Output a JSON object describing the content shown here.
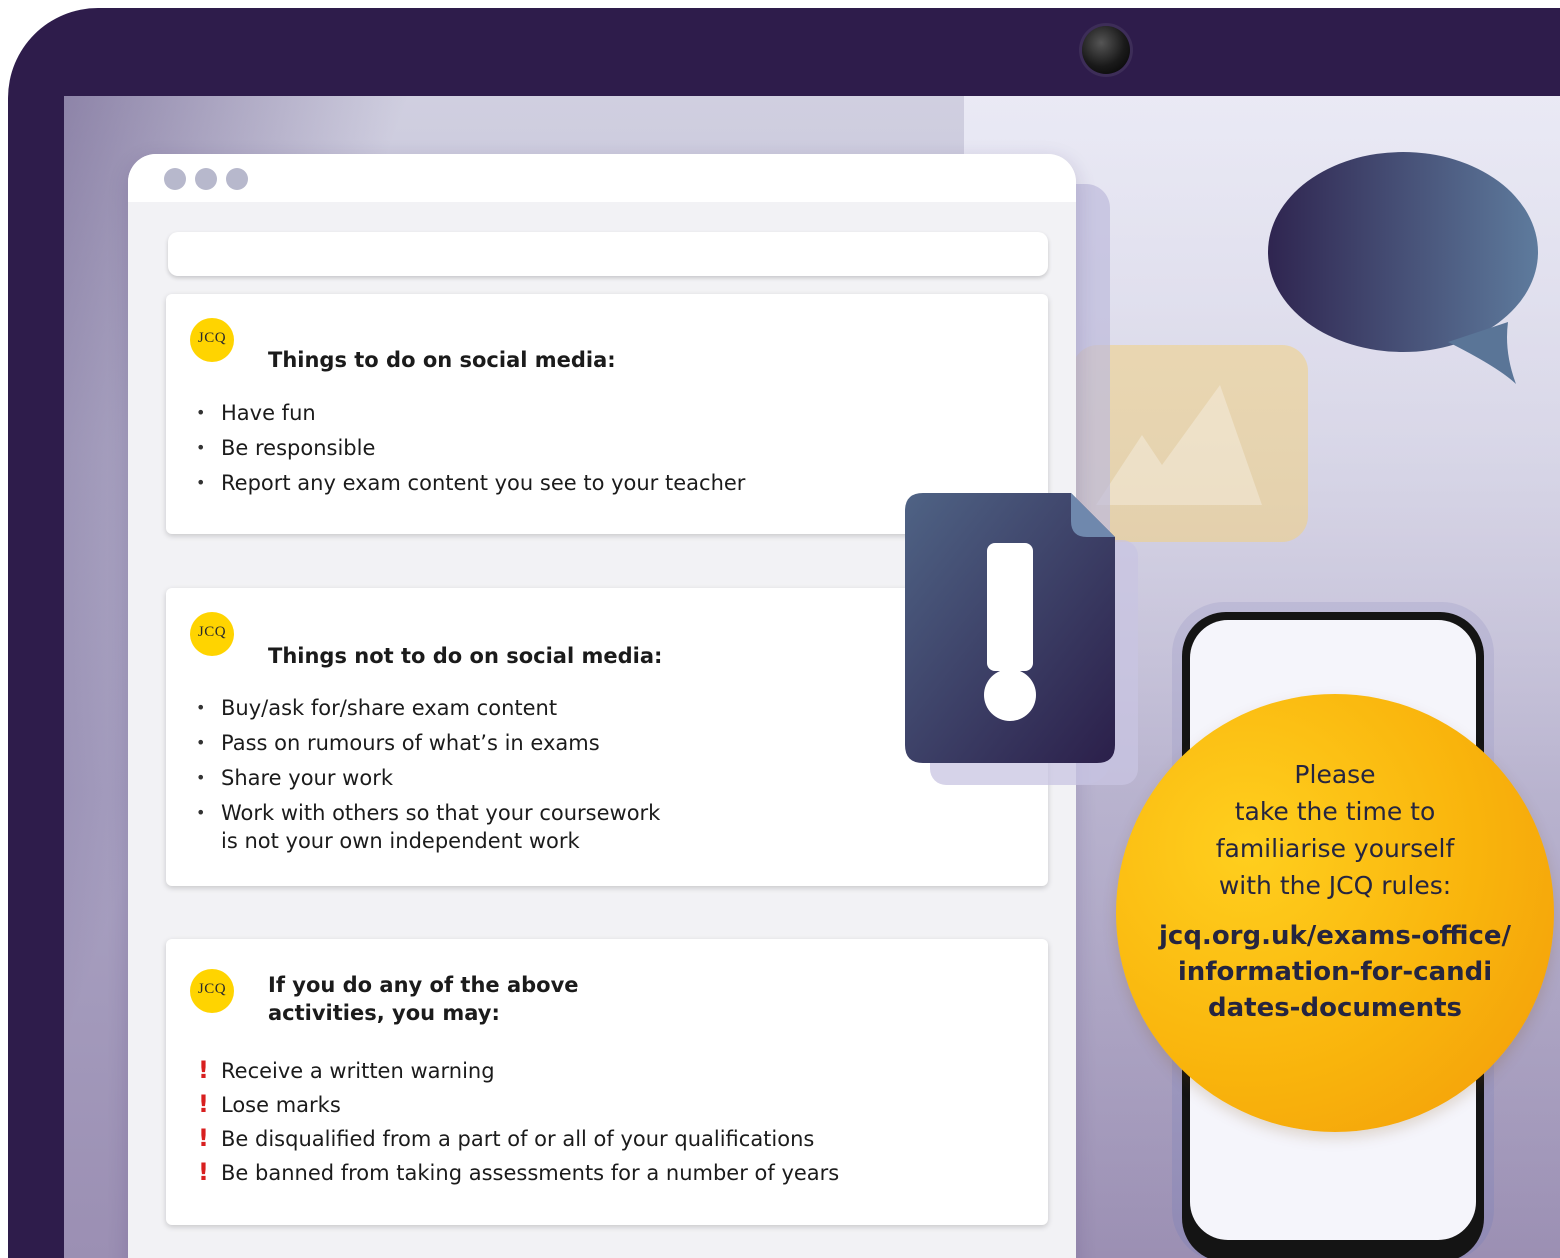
{
  "cards": [
    {
      "logo": "JCQ",
      "title": "Things to do on social media:",
      "items": [
        "Have fun",
        "Be responsible",
        "Report any exam content you see to your teacher"
      ]
    },
    {
      "logo": "JCQ",
      "title": "Things not to do on social media:",
      "items": [
        "Buy/ask for/share exam content",
        "Pass on rumours of what’s in exams",
        "Share your work",
        "Work with others so that your coursework",
        "is not your own independent work"
      ]
    },
    {
      "logo": "JCQ",
      "title_line1": "If you do any of the above",
      "title_line2": "activities, you may:",
      "items": [
        "Receive a written warning",
        "Lose marks",
        "Be disqualified from a part of or all of your qualifications",
        "Be banned from taking assessments for a number of years"
      ]
    }
  ],
  "callout": {
    "lines": [
      "Please",
      "take the time to",
      "familiarise yourself",
      "with the JCQ rules:"
    ],
    "link_lines": [
      "jcq.org.uk/exams-office/",
      "information-for-candi",
      "dates-documents"
    ]
  },
  "colors": {
    "frame": "#2e1c4b",
    "logo": "#ffd400",
    "warning": "#d81f1f",
    "callout": "#f9b40c"
  },
  "icons": [
    "webcam-icon",
    "speech-bubble-icon",
    "image-icon",
    "alert-document-icon",
    "phone-icon"
  ]
}
